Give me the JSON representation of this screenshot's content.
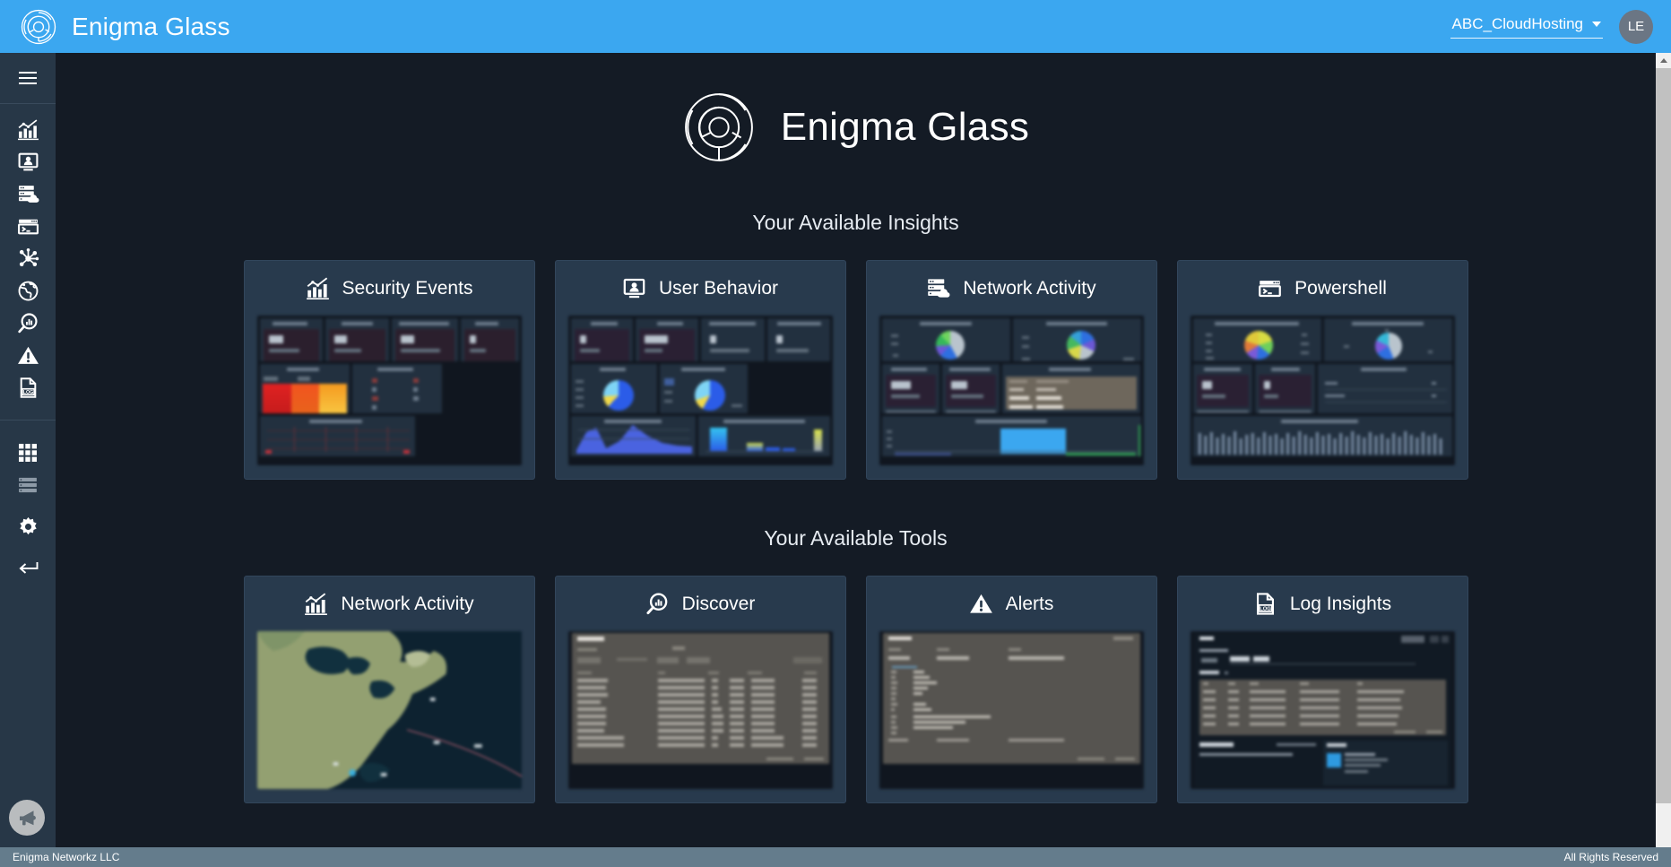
{
  "app": {
    "title": "Enigma Glass",
    "logo_icon": "enigma-ring-logo"
  },
  "topbar": {
    "tenant": "ABC_CloudHosting",
    "tenant_caret_icon": "chevron-down-icon",
    "avatar_initials": "LE"
  },
  "sidebar": {
    "menu_icon": "hamburger-menu-icon",
    "items": [
      {
        "name": "security-events",
        "icon": "bar-chart-trend-icon"
      },
      {
        "name": "user-behavior",
        "icon": "user-monitor-icon"
      },
      {
        "name": "network-activity",
        "icon": "cloud-server-icon"
      },
      {
        "name": "powershell",
        "icon": "terminal-prompt-icon"
      },
      {
        "name": "network-graph",
        "icon": "node-network-icon"
      },
      {
        "name": "globe",
        "icon": "globe-icon"
      },
      {
        "name": "discover",
        "icon": "magnifier-chart-icon"
      },
      {
        "name": "alerts",
        "icon": "alert-triangle-icon"
      },
      {
        "name": "log-insights",
        "icon": "log-file-icon"
      }
    ],
    "bottom_items": [
      {
        "name": "apps-grid",
        "icon": "grid-apps-icon"
      },
      {
        "name": "lists",
        "icon": "list-rows-icon"
      },
      {
        "name": "settings",
        "icon": "gear-icon"
      },
      {
        "name": "back",
        "icon": "back-arrow-icon"
      }
    ],
    "announce_icon": "megaphone-icon"
  },
  "hero": {
    "title": "Enigma Glass",
    "logo_icon": "enigma-ring-logo"
  },
  "sections": [
    {
      "heading": "Your Available Insights",
      "cards": [
        {
          "label": "Security Events",
          "icon": "bar-chart-trend-icon",
          "preview": "security-events-dashboard",
          "accent": "#d93b3b"
        },
        {
          "label": "User Behavior",
          "icon": "user-monitor-icon",
          "preview": "user-behavior-dashboard",
          "accent": "#3b5bdb"
        },
        {
          "label": "Network Activity",
          "icon": "cloud-server-icon",
          "preview": "network-activity-dashboard",
          "accent": "#3ba7f0"
        },
        {
          "label": "Powershell",
          "icon": "terminal-prompt-icon",
          "preview": "powershell-dashboard",
          "accent": "#8fa2b5"
        }
      ]
    },
    {
      "heading": "Your Available Tools",
      "cards": [
        {
          "label": "Network Activity",
          "icon": "bar-chart-trend-icon",
          "preview": "world-map",
          "accent": "#6d8a5a"
        },
        {
          "label": "Discover",
          "icon": "magnifier-chart-icon",
          "preview": "discover-table",
          "accent": "#5c5c5c"
        },
        {
          "label": "Alerts",
          "icon": "alert-triangle-icon",
          "preview": "alerts-detail",
          "accent": "#5c5c5c"
        },
        {
          "label": "Log Insights",
          "icon": "log-file-icon",
          "preview": "log-insights-rules",
          "accent": "#5c5c5c"
        }
      ]
    }
  ],
  "footer": {
    "left": "Enigma Networkz LLC",
    "right": "All Rights Reserved"
  },
  "scrollbar": {
    "up_icon": "scroll-up-arrow-icon"
  },
  "colors": {
    "topbar": "#3ba7f0",
    "sidebar": "#273747",
    "page_bg": "#141b25",
    "card_bg": "#283a4d",
    "footer_bg": "#647c8c"
  }
}
